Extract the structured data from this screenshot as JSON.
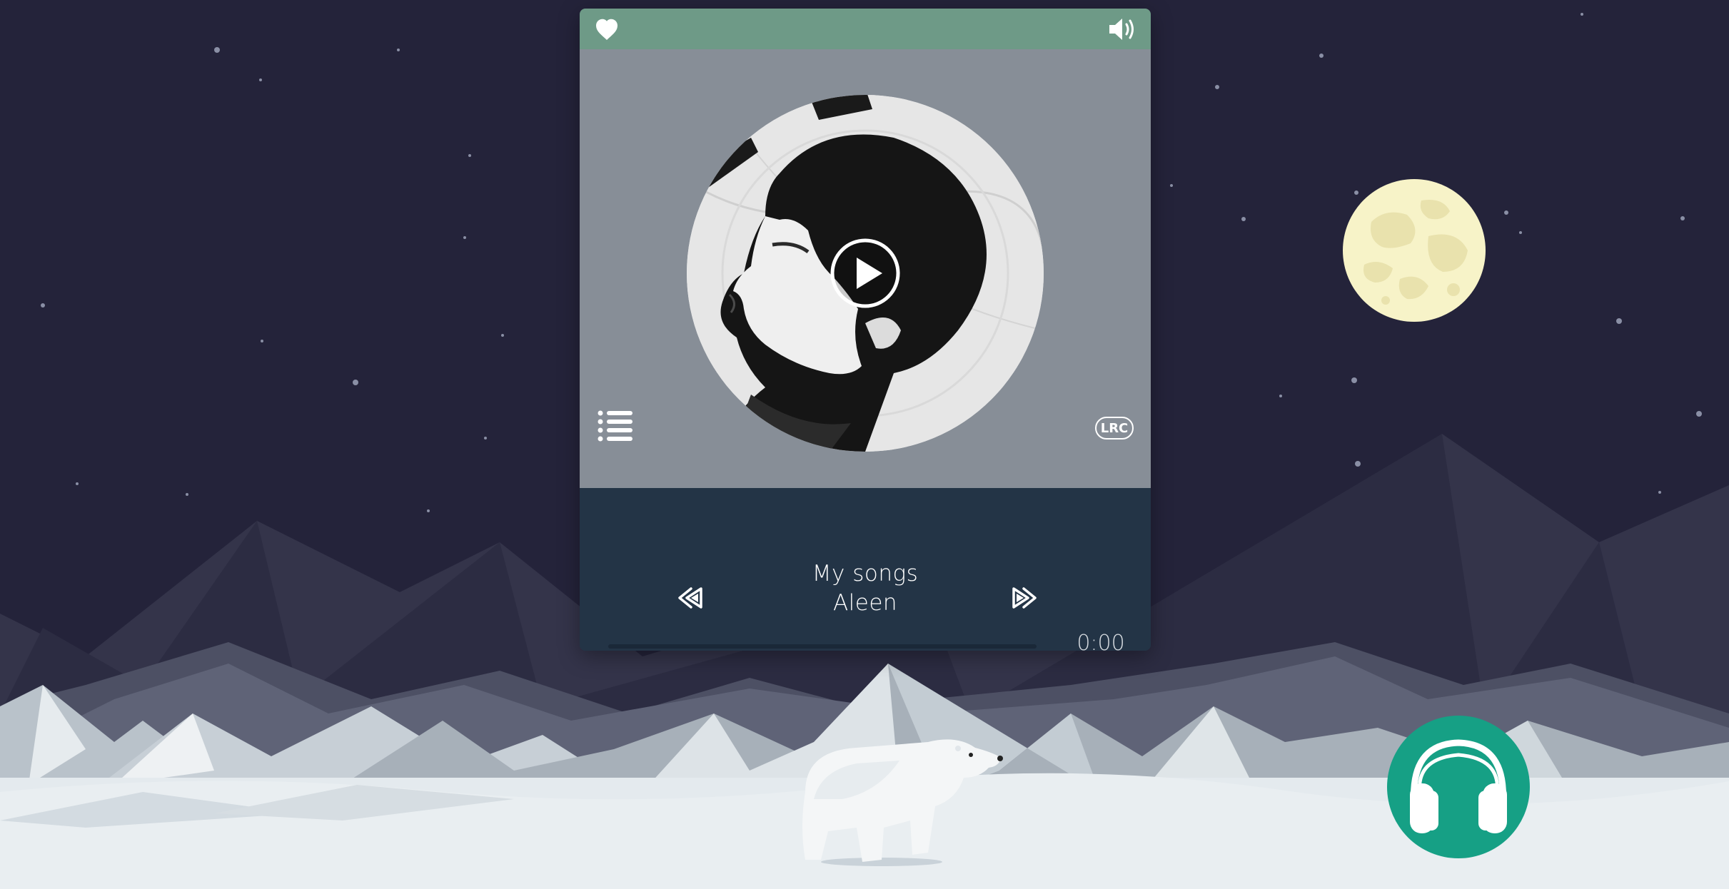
{
  "player": {
    "favorite_icon": "heart-icon",
    "volume_icon": "volume-icon",
    "playlist_icon": "list-icon",
    "play_icon": "play-icon",
    "lyrics_label": "LRC",
    "prev_icon": "rewind-icon",
    "next_icon": "fast-forward-icon",
    "song_title": "My songs",
    "artist": "Aleen",
    "time": "0:00",
    "progress": 0
  },
  "floating": {
    "headphones_icon": "headphones-icon"
  },
  "colors": {
    "sky": "#24233a",
    "header": "#6e9a87",
    "cover_panel": "#878e97",
    "controls_panel": "#233446",
    "moon": "#f7f3c8",
    "headphones_button": "#16a085"
  }
}
